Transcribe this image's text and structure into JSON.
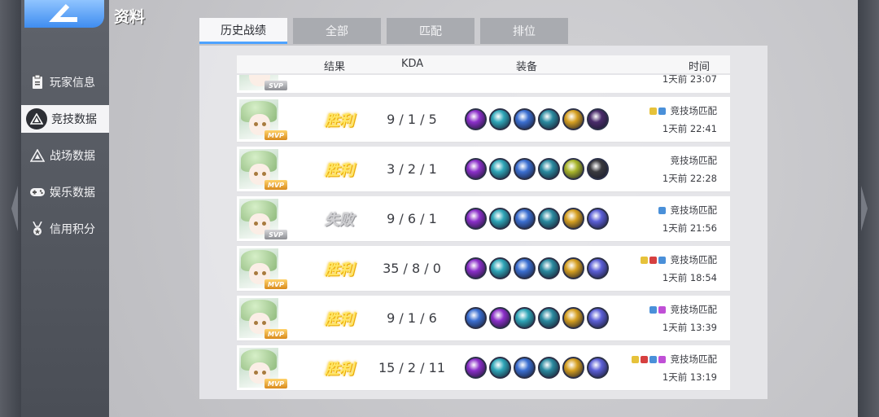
{
  "app": {
    "title": "资料"
  },
  "nav": [
    {
      "label": "玩家信息",
      "icon": "clipboard-icon",
      "active": false
    },
    {
      "label": "竞技数据",
      "icon": "triangle-emblem-icon",
      "active": true
    },
    {
      "label": "战场数据",
      "icon": "shield-emblem-icon",
      "active": false
    },
    {
      "label": "娱乐数据",
      "icon": "gamepad-icon",
      "active": false
    },
    {
      "label": "信用积分",
      "icon": "medal-icon",
      "active": false
    }
  ],
  "tabs": [
    {
      "label": "历史战绩",
      "active": true
    },
    {
      "label": "全部",
      "active": false
    },
    {
      "label": "匹配",
      "active": false
    },
    {
      "label": "排位",
      "active": false
    }
  ],
  "columns": {
    "result": "结果",
    "kda": "KDA",
    "equipment": "装备",
    "time": "时间"
  },
  "partial_row": {
    "badge": "SVP",
    "time": "1天前 23:07"
  },
  "matches": [
    {
      "badge": "MVP",
      "result": "胜利",
      "result_type": "win",
      "kda": "9 / 1 / 5",
      "mode": "竞技场匹配",
      "time": "1天前  22:41",
      "tags": [
        "#e6c23a",
        "#4a90d9"
      ],
      "equip": [
        "#8b2fc9",
        "#2fa6b8",
        "#3b6fd1",
        "#2b8aa0",
        "#d6a021",
        "#4a2c6b"
      ]
    },
    {
      "badge": "MVP",
      "result": "胜利",
      "result_type": "win",
      "kda": "3 / 2 / 1",
      "mode": "竞技场匹配",
      "time": "1天前  22:28",
      "tags": [],
      "equip": [
        "#8b2fc9",
        "#2fa6b8",
        "#3b6fd1",
        "#2b8aa0",
        "#a8b52a",
        "#3a3a3f"
      ]
    },
    {
      "badge": "SVP",
      "result": "失败",
      "result_type": "loss",
      "kda": "9 / 6 / 1",
      "mode": "竞技场匹配",
      "time": "1天前  21:56",
      "tags": [
        "#4a90d9"
      ],
      "equip": [
        "#8b2fc9",
        "#2fa6b8",
        "#3b6fd1",
        "#2b8aa0",
        "#d6a021",
        "#5b5fd6"
      ]
    },
    {
      "badge": "MVP",
      "result": "胜利",
      "result_type": "win",
      "kda": "35 / 8 / 0",
      "mode": "竞技场匹配",
      "time": "1天前  18:54",
      "tags": [
        "#e6c23a",
        "#d64040",
        "#4a90d9"
      ],
      "equip": [
        "#8b2fc9",
        "#2fa6b8",
        "#3b6fd1",
        "#2b8aa0",
        "#d6a021",
        "#5b5fd6"
      ]
    },
    {
      "badge": "MVP",
      "result": "胜利",
      "result_type": "win",
      "kda": "9 / 1 / 6",
      "mode": "竞技场匹配",
      "time": "1天前  13:39",
      "tags": [
        "#4a90d9",
        "#c04fd6"
      ],
      "equip": [
        "#3b6fd1",
        "#8b2fc9",
        "#2fa6b8",
        "#2b8aa0",
        "#d6a021",
        "#5b5fd6"
      ]
    },
    {
      "badge": "MVP",
      "result": "胜利",
      "result_type": "win",
      "kda": "15 / 2 / 11",
      "mode": "竞技场匹配",
      "time": "1天前  13:19",
      "tags": [
        "#e6c23a",
        "#d64040",
        "#4a90d9",
        "#c04fd6"
      ],
      "equip": [
        "#8b2fc9",
        "#2fa6b8",
        "#3b6fd1",
        "#2b8aa0",
        "#d6a021",
        "#5b5fd6"
      ]
    }
  ]
}
